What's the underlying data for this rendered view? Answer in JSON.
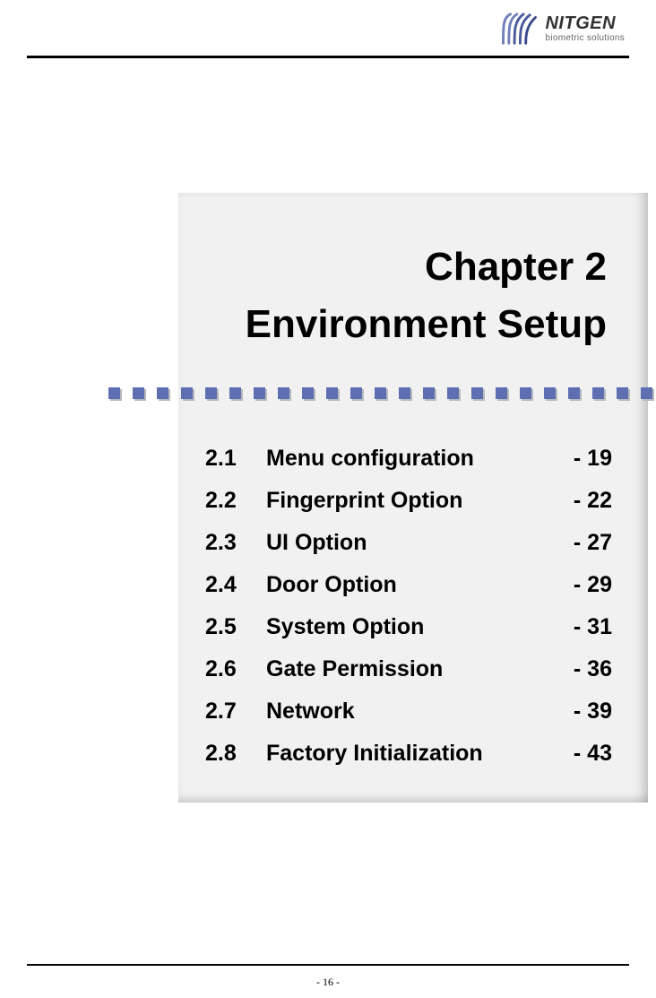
{
  "brand": {
    "name": "NITGEN",
    "subtitle": "biometric solutions"
  },
  "chapter": {
    "line1": "Chapter 2",
    "line2": "Environment Setup"
  },
  "toc": [
    {
      "num": "2.1",
      "title": "Menu configuration",
      "page": "- 19"
    },
    {
      "num": "2.2",
      "title": "Fingerprint Option",
      "page": "- 22"
    },
    {
      "num": "2.3",
      "title": "UI Option",
      "page": "- 27"
    },
    {
      "num": "2.4",
      "title": "Door Option",
      "page": "- 29"
    },
    {
      "num": "2.5",
      "title": "System Option",
      "page": "- 31"
    },
    {
      "num": "2.6",
      "title": "Gate Permission",
      "page": "- 36"
    },
    {
      "num": "2.7",
      "title": "Network",
      "page": "- 39"
    },
    {
      "num": "2.8",
      "title": "Factory Initialization",
      "page": "- 43"
    }
  ],
  "footer": {
    "page_number": "- 16 -"
  }
}
